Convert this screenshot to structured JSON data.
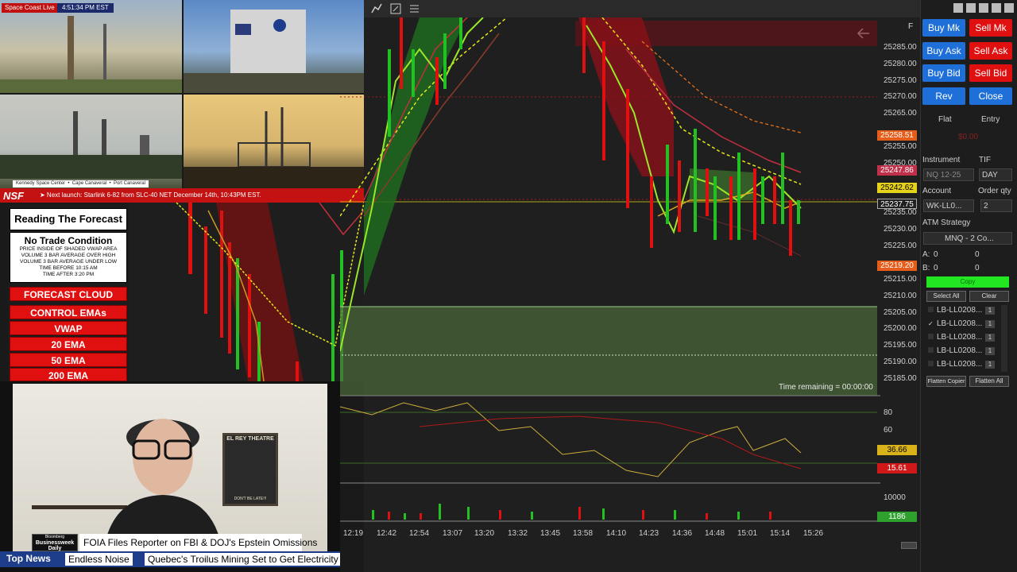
{
  "stream": {
    "cam_label": "Space Coast Live",
    "cam_time": "4:51:34 PM EST",
    "cam_locations": "Kennedy Space Center  •  Cape Canaveral  •  Port Canaveral",
    "launch_logo": "NSF",
    "launch_banner": "➤ Next launch: Starlink 6-82 from SLC-40 NET December 14th, 10:43PM EST."
  },
  "forecast": {
    "title": "Reading The Forecast",
    "condition_title": "No Trade Condition",
    "conditions": [
      "PRICE INSIDE OF SHADED VWAP AREA",
      "VOLUME 3 BAR AVERAGE OVER HIGH",
      "VOLUME 3 BAR AVERAGE UNDER LOW",
      "TIME BEFORE 10:15 AM",
      "TIME AFTER 3:20 PM"
    ],
    "legend": [
      "FORECAST CLOUD",
      "CONTROL EMAs",
      "VWAP",
      "20 EMA",
      "50 EMA",
      "200 EMA"
    ]
  },
  "news": {
    "poster_title": "EL REY THEATRE",
    "poster_bottom": "DON'T BE LATE!!!",
    "network_small": "Bloomberg",
    "network_name": "Businessweek Daily",
    "headline": "FOIA Files Reporter on FBI & DOJ's Epstein Omissions",
    "ticker_label": "Top News",
    "ticker_items": [
      "Endless Noise",
      "Quebec's Troilus Mining  Set to Get Electricity"
    ]
  },
  "chart": {
    "time_remaining": "Time remaining = 00:00:00",
    "price_axis": [
      "25285.00",
      "25280.00",
      "25275.00",
      "25270.00",
      "25265.00",
      "25260.00",
      "25255.00",
      "25250.00",
      "25245.00",
      "25240.00",
      "25235.00",
      "25230.00",
      "25225.00",
      "25220.00",
      "25215.00",
      "25210.00",
      "25205.00",
      "25200.00",
      "25195.00",
      "25190.00",
      "25185.00"
    ],
    "price_tags": [
      {
        "label": "25258.51",
        "color": "#e65c1a"
      },
      {
        "label": "25247.86",
        "color": "#c0304a"
      },
      {
        "label": "25242.62",
        "color": "#e6d21a"
      },
      {
        "label": "25237.75",
        "color": "#202020"
      },
      {
        "label": "25219.20",
        "color": "#e65c1a"
      }
    ],
    "osc_axis": [
      "80",
      "60",
      "40"
    ],
    "osc_tags": [
      {
        "label": "36.66",
        "color": "#d9b21a"
      },
      {
        "label": "15.61",
        "color": "#d01818"
      }
    ],
    "vol_axis": "10000",
    "vol_tag": "1186",
    "time_axis": [
      "12:19",
      "12:42",
      "12:54",
      "13:07",
      "13:20",
      "13:32",
      "13:45",
      "13:58",
      "14:10",
      "14:23",
      "14:36",
      "14:48",
      "15:01",
      "15:14",
      "15:26"
    ],
    "f_label": "F"
  },
  "chart_data": {
    "type": "candlestick",
    "title": "",
    "xlabel": "",
    "ylabel": "",
    "ylim": [
      25183,
      25289
    ],
    "x": [
      "12:19",
      "12:42",
      "12:54",
      "13:07",
      "13:20",
      "13:32",
      "13:45",
      "13:58",
      "14:10",
      "14:23",
      "14:36",
      "14:48",
      "15:01",
      "15:14",
      "15:26"
    ],
    "last_price": 25237.75,
    "levels": [
      25258.51,
      25247.86,
      25242.62,
      25237.75,
      25219.2
    ],
    "oscillator_values": [
      36.66,
      15.61
    ],
    "volume_last": 1186
  },
  "panel": {
    "buttons": [
      {
        "label": "Buy Mk",
        "color": "#1e6fd8"
      },
      {
        "label": "Sell Mk",
        "color": "#e01010"
      },
      {
        "label": "Buy Ask",
        "color": "#1e6fd8"
      },
      {
        "label": "Sell Ask",
        "color": "#e01010"
      },
      {
        "label": "Buy Bid",
        "color": "#1e6fd8"
      },
      {
        "label": "Sell Bid",
        "color": "#e01010"
      },
      {
        "label": "Rev",
        "color": "#1e6fd8"
      },
      {
        "label": "Close",
        "color": "#1e6fd8"
      }
    ],
    "flat": "Flat",
    "entry": "Entry",
    "pnl": "$0.00",
    "instrument_label": "Instrument",
    "instrument_value": "NQ 12-25",
    "tif_label": "TIF",
    "tif_value": "DAY",
    "account_label": "Account",
    "account_value": "WK-LL0...",
    "qty_label": "Order qty",
    "qty_value": "2",
    "atm_label": "ATM Strategy",
    "atm_value": "MNQ - 2 Co...",
    "a_label": "A:",
    "a_val1": "0",
    "a_val2": "0",
    "b_label": "B:",
    "b_val1": "0",
    "b_val2": "0",
    "copy_label": "Copy",
    "select_all": "Select All",
    "clear": "Clear",
    "accounts": [
      {
        "name": "LB-LL0208...",
        "qty": "1",
        "checked": false
      },
      {
        "name": "LB-LL0208...",
        "qty": "1",
        "checked": true
      },
      {
        "name": "LB-LL0208...",
        "qty": "1",
        "checked": false
      },
      {
        "name": "LB-LL0208...",
        "qty": "1",
        "checked": false
      },
      {
        "name": "LB-LL0208...",
        "qty": "1",
        "checked": false
      }
    ],
    "flatten_copier": "Flatten Copier",
    "flatten_all": "Flatten All"
  }
}
